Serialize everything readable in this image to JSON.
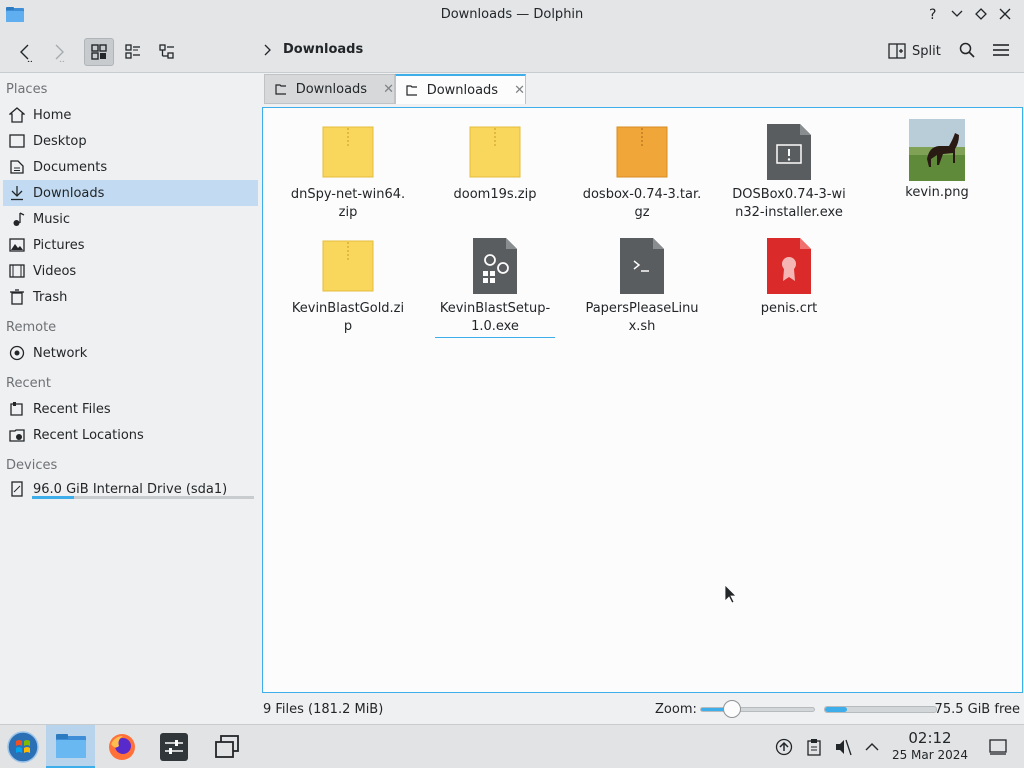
{
  "window": {
    "title": "Downloads — Dolphin"
  },
  "toolbar": {
    "current_folder": "Downloads",
    "split_label": "Split"
  },
  "sidebar": {
    "places_title": "Places",
    "places": [
      {
        "label": "Home",
        "icon": "home-icon"
      },
      {
        "label": "Desktop",
        "icon": "desktop-icon"
      },
      {
        "label": "Documents",
        "icon": "documents-icon"
      },
      {
        "label": "Downloads",
        "icon": "downloads-icon",
        "selected": true
      },
      {
        "label": "Music",
        "icon": "music-icon"
      },
      {
        "label": "Pictures",
        "icon": "pictures-icon"
      },
      {
        "label": "Videos",
        "icon": "videos-icon"
      },
      {
        "label": "Trash",
        "icon": "trash-icon"
      }
    ],
    "remote_title": "Remote",
    "remote": [
      {
        "label": "Network",
        "icon": "network-icon"
      }
    ],
    "recent_title": "Recent",
    "recent": [
      {
        "label": "Recent Files",
        "icon": "recent-files-icon"
      },
      {
        "label": "Recent Locations",
        "icon": "recent-locations-icon"
      }
    ],
    "devices_title": "Devices",
    "devices": [
      {
        "label": "96.0 GiB Internal Drive (sda1)",
        "icon": "drive-icon",
        "usage": 0.19
      }
    ]
  },
  "tabs": [
    {
      "label": "Downloads",
      "active": false
    },
    {
      "label": "Downloads",
      "active": true
    }
  ],
  "files": [
    {
      "name": "dnSpy-net-win64.zip",
      "icon": "zip-archive-icon"
    },
    {
      "name": "doom19s.zip",
      "icon": "zip-archive-icon"
    },
    {
      "name": "dosbox-0.74-3.tar.gz",
      "icon": "targz-archive-icon"
    },
    {
      "name": "DOSBox0.74-3-win32-installer.exe",
      "icon": "exe-icon"
    },
    {
      "name": "kevin.png",
      "icon": "image-thumbnail-icon"
    },
    {
      "name": "KevinBlastGold.zip",
      "icon": "zip-archive-icon"
    },
    {
      "name": "KevinBlastSetup-1.0.exe",
      "icon": "exe-setup-icon"
    },
    {
      "name": "PapersPleaseLinux.sh",
      "icon": "shell-script-icon"
    },
    {
      "name": "penis.crt",
      "icon": "certificate-icon"
    }
  ],
  "status": {
    "summary": "9 Files (181.2 MiB)",
    "zoom_label": "Zoom:",
    "zoom_level": 0.3,
    "free_space": "75.5 GiB free",
    "used_fraction": 0.2
  },
  "taskbar": {
    "time": "02:12",
    "date": "25 Mar 2024"
  },
  "colors": {
    "accent": "#3daee9",
    "selection": "#c2dbf2",
    "zip_yellow": "#f9d65c",
    "targz_orange": "#f1a63a",
    "cert_red": "#da2a2a"
  }
}
